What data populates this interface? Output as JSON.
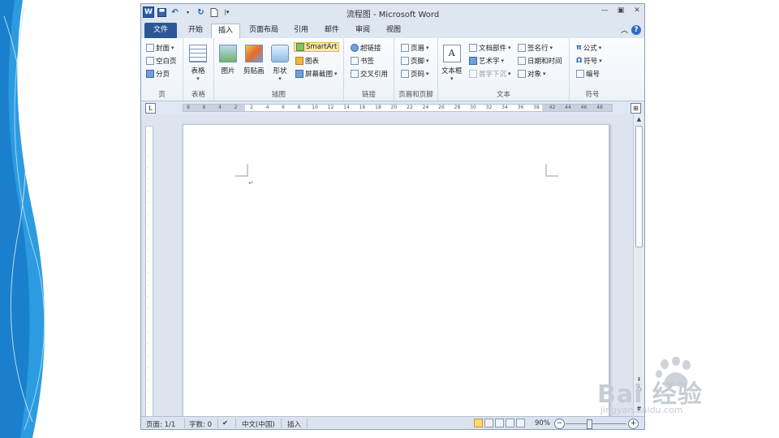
{
  "window": {
    "title": "流程图 - Microsoft Word"
  },
  "qat": [
    "word-logo",
    "save-icon",
    "undo-icon",
    "redo-icon",
    "new-doc-icon",
    "customize-icon"
  ],
  "tabs": [
    {
      "label": "文件"
    },
    {
      "label": "开始"
    },
    {
      "label": "插入"
    },
    {
      "label": "页面布局"
    },
    {
      "label": "引用"
    },
    {
      "label": "邮件"
    },
    {
      "label": "审阅"
    },
    {
      "label": "视图"
    }
  ],
  "active_tab": "插入",
  "ribbon": {
    "pages": {
      "label": "页",
      "items": [
        {
          "label": "封面"
        },
        {
          "label": "空白页"
        },
        {
          "label": "分页"
        }
      ]
    },
    "tables": {
      "label": "表格",
      "items": [
        {
          "label": "表格"
        }
      ]
    },
    "illustrations": {
      "label": "插图",
      "items": [
        {
          "label": "图片"
        },
        {
          "label": "剪贴画"
        },
        {
          "label": "形状"
        },
        {
          "label": "SmartArt"
        },
        {
          "label": "图表"
        },
        {
          "label": "屏幕截图"
        }
      ]
    },
    "links": {
      "label": "链接",
      "items": [
        {
          "label": "超链接"
        },
        {
          "label": "书签"
        },
        {
          "label": "交叉引用"
        }
      ]
    },
    "header_footer": {
      "label": "页眉和页脚",
      "items": [
        {
          "label": "页眉"
        },
        {
          "label": "页脚"
        },
        {
          "label": "页码"
        }
      ]
    },
    "text": {
      "label": "文本",
      "items": [
        {
          "label": "文本框"
        },
        {
          "label": "文档部件"
        },
        {
          "label": "艺术字"
        },
        {
          "label": "首字下沉"
        },
        {
          "label": "签名行"
        },
        {
          "label": "日期和时间"
        },
        {
          "label": "对象"
        }
      ]
    },
    "symbols": {
      "label": "符号",
      "items": [
        {
          "label": "公式"
        },
        {
          "label": "符号"
        },
        {
          "label": "编号"
        }
      ]
    }
  },
  "ruler": {
    "ticks": [
      "8",
      "6",
      "4",
      "2",
      "2",
      "4",
      "6",
      "8",
      "10",
      "12",
      "14",
      "16",
      "18",
      "20",
      "22",
      "24",
      "26",
      "28",
      "30",
      "32",
      "34",
      "36",
      "38",
      "42",
      "44",
      "46",
      "48"
    ]
  },
  "status": {
    "page": "页面: 1/1",
    "words": "字数: 0",
    "language": "中文(中国)",
    "mode": "插入",
    "zoom": "90%"
  },
  "watermark": {
    "text": "Bai 经验",
    "url": "jingyan.baidu.com"
  }
}
